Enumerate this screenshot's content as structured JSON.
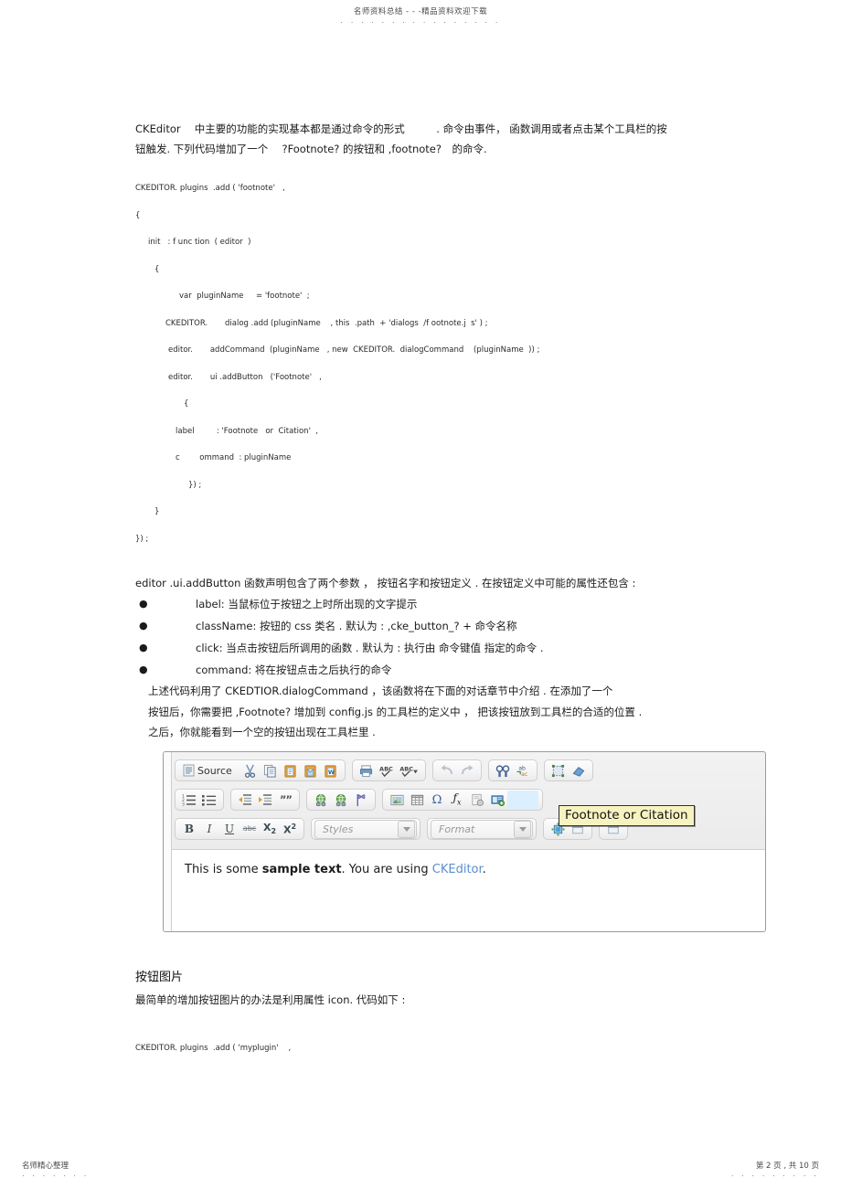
{
  "page": {
    "header_text": "名师资料总结 - - -精品资料欢迎下载",
    "header_dots": "· · · · · · · · · · · · · · · ·",
    "footer_left_text": "名师精心整理",
    "footer_left_dots": "· · · · · · ·",
    "footer_right_text": "第 2 页 , 共 10 页",
    "footer_right_dots": "· · · · · · · · ·"
  },
  "intro": {
    "line1": "CKEditor　 中主要的功能的实现基本都是通过命令的形式　　　. 命令由事件， 函数调用或者点击某个工具栏的按",
    "line2": "钮触发. 下列代码增加了一个　 ?Footnote? 的按钮和 ,footnote?　的命令."
  },
  "code1": {
    "lines": [
      "CKEDITOR. plugins  .add ( 'footnote'   ,",
      "{",
      "init   : f unc tion  ( editor  )",
      "{",
      "var  pluginName     = 'footnote'  ;",
      "CKEDITOR.       dialog .add (pluginName    , this  .path  + 'dialogs  /f ootnote.j  s' ) ;",
      "editor.       addCommand  (pluginName   , new  CKEDITOR.  dialogCommand    (pluginName  )) ;",
      "editor.       ui .addButton   ('Footnote'   ,",
      "{",
      "label         : 'Footnote   or  Citation'  ,",
      "c        ommand  : pluginName",
      "}) ;",
      "}",
      "}) ;"
    ]
  },
  "attrs": {
    "heading": "editor  .ui.addButton        函数声明包含了两个参数    ， 按钮名字和按钮定义  . 在按钮定义中可能的属性还包含     :",
    "items": [
      "label:     当鼠标位于按钮之上时所出现的文字提示",
      "className:      按钮的  css  类名 . 默认为 : ,cke_button_? +        命令名称",
      "click:   当点击按钮后所调用的函数     . 默认为 : 执行由  命令键值   指定的命令 .",
      "command:      将在按钮点击之后执行的命令"
    ],
    "para_lines": [
      "上述代码利用了   CKEDTIOR.dialogCommand            ，该函数将在下面的对话章节中介绍     . 在添加了一个",
      "按钮后，你需要把 ,Footnote?  增加到 config.js     的工具栏的定义中   ， 把该按钮放到工具栏的合适的位置       .",
      "之后，你就能看到一个空的按钮出现在工具栏里          ."
    ]
  },
  "editor_shot": {
    "source_label": "Source",
    "styles_placeholder": "Styles",
    "format_placeholder": "Format",
    "tooltip_text": "Footnote or Citation",
    "sample_prefix": "This is some ",
    "sample_bold": "sample text",
    "sample_middle": ". You are using ",
    "sample_link": "CKEditor",
    "sample_suffix": ".",
    "toolbar": {
      "row1": [
        {
          "name": "source-button",
          "label": "Source",
          "glyph": ""
        },
        {
          "name": "cut-icon",
          "glyph": "✂"
        },
        {
          "name": "copy-icon",
          "glyph": "❐"
        },
        {
          "name": "paste-icon",
          "glyph": "📋"
        },
        {
          "name": "paste-text-icon",
          "glyph": "📄"
        },
        {
          "name": "paste-from-word-icon",
          "glyph": "📑"
        },
        {
          "name": "print-icon",
          "glyph": "🖶"
        },
        {
          "name": "spellcheck-icon",
          "glyph": "ABC"
        },
        {
          "name": "spellcheck-as-you-type-icon",
          "glyph": "ABC"
        },
        {
          "name": "undo-icon",
          "glyph": "↰"
        },
        {
          "name": "redo-icon",
          "glyph": "↱"
        },
        {
          "name": "find-icon",
          "glyph": "🔍"
        },
        {
          "name": "replace-icon",
          "glyph": "ab"
        },
        {
          "name": "select-all-icon",
          "glyph": "▣"
        },
        {
          "name": "remove-format-icon",
          "glyph": "🧽"
        }
      ],
      "row2": [
        {
          "name": "numbered-list-icon",
          "glyph": "⒈"
        },
        {
          "name": "bulleted-list-icon",
          "glyph": "☰"
        },
        {
          "name": "decrease-indent-icon",
          "glyph": "◀"
        },
        {
          "name": "increase-indent-icon",
          "glyph": "▶"
        },
        {
          "name": "blockquote-icon",
          "glyph": "❞"
        },
        {
          "name": "link-icon",
          "glyph": "🌐"
        },
        {
          "name": "unlink-icon",
          "glyph": "🌐"
        },
        {
          "name": "anchor-icon",
          "glyph": "⚑"
        },
        {
          "name": "image-icon",
          "glyph": "🖼"
        },
        {
          "name": "table-icon",
          "glyph": "▦"
        },
        {
          "name": "special-char-icon",
          "glyph": "Ω"
        },
        {
          "name": "math-formula-icon",
          "glyph": "ƒx"
        },
        {
          "name": "page-break-icon",
          "glyph": "⎙"
        },
        {
          "name": "template-icon",
          "glyph": "▤"
        },
        {
          "name": "empty-button-slot",
          "glyph": ""
        }
      ],
      "row3": [
        {
          "name": "bold-icon",
          "glyph": "B"
        },
        {
          "name": "italic-icon",
          "glyph": "I"
        },
        {
          "name": "underline-icon",
          "glyph": "U"
        },
        {
          "name": "strikethrough-icon",
          "glyph": "abc"
        },
        {
          "name": "subscript-icon",
          "glyph": "X₂"
        },
        {
          "name": "superscript-icon",
          "glyph": "X²"
        },
        {
          "name": "footnote-icon",
          "glyph": "◈"
        },
        {
          "name": "maximize-icon",
          "glyph": "⛶"
        },
        {
          "name": "show-blocks-icon",
          "glyph": "▭"
        }
      ]
    }
  },
  "section2": {
    "title": "按钮图片",
    "para": "最简单的增加按钮图片的办法是利用属性        icon.    代码如下 :",
    "code": "CKEDITOR. plugins  .add ( 'myplugin'    ,"
  }
}
